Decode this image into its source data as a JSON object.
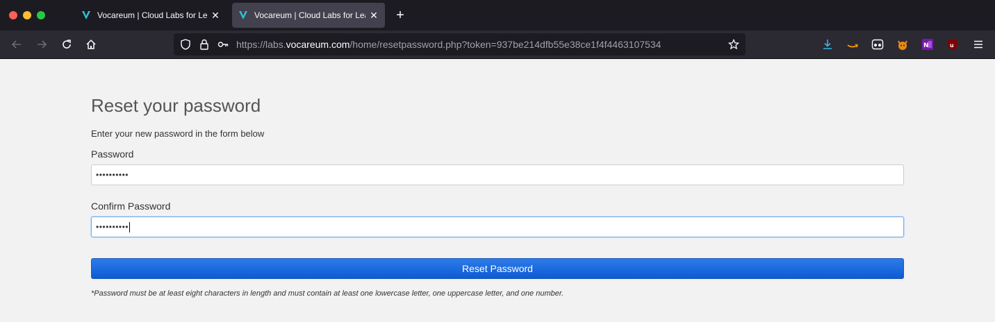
{
  "browser": {
    "tabs": [
      {
        "title": "Vocareum | Cloud Labs for Learn",
        "active": false
      },
      {
        "title": "Vocareum | Cloud Labs for Learn",
        "active": true
      }
    ],
    "url_prefix": "https://labs.",
    "url_domain": "vocareum.com",
    "url_path": "/home/resetpassword.php?token=937be214dfb55e38ce1f4f4463107534",
    "extension_badge": "3",
    "accent_color": "#0c5bd4",
    "chrome_bg": "#1c1b22"
  },
  "page": {
    "heading": "Reset your password",
    "subtext": "Enter your new password in the form below",
    "password_label": "Password",
    "password_value": "••••••••••",
    "confirm_label": "Confirm Password",
    "confirm_value": "••••••••••",
    "submit_label": "Reset Password",
    "note": "*Password must be at least eight characters in length and must contain at least one lowercase letter, one uppercase letter, and one number."
  },
  "icons": [
    "back-icon",
    "forward-icon",
    "reload-icon",
    "home-icon",
    "shield-icon",
    "lock-icon",
    "key-icon",
    "star-icon",
    "download-icon",
    "amazon-icon",
    "mask-icon",
    "cat-icon",
    "onenote-icon",
    "ublock-icon",
    "menu-icon"
  ]
}
